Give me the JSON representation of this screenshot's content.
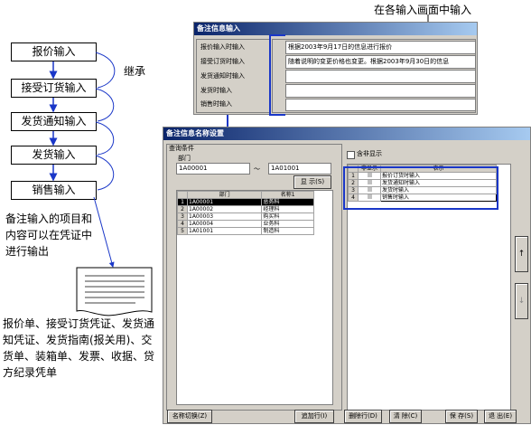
{
  "flow": {
    "steps": [
      "报价输入",
      "接受订货输入",
      "发货通知输入",
      "发货输入",
      "销售输入"
    ],
    "inherit_label": "继承",
    "note_lines": [
      "备注输入的项目和",
      "内容可以在凭证中",
      "进行输出"
    ],
    "docs_lines": [
      "报价单、接受订货凭证、发货通",
      "知凭证、发货指南(报关用)、交",
      "货单、装箱单、发票、收据、贷",
      "方纪录凭单"
    ]
  },
  "callout": "在各输入画面中输入",
  "remarks_window": {
    "title": "备注信息输入",
    "rows": [
      {
        "label": "报价输入时输入",
        "value": "根据2003年9月17日的信息进行报价"
      },
      {
        "label": "接受订货时输入",
        "value": "随着说明的变更价格也变更。根据2003年9月30日的信息"
      },
      {
        "label": "发货通知时输入",
        "value": ""
      },
      {
        "label": "发货时输入",
        "value": ""
      },
      {
        "label": "销售时输入",
        "value": ""
      }
    ]
  },
  "settings_window": {
    "title": "备注信息名称设置",
    "query_group": "查询条件",
    "dept_label": "部门",
    "dept_from": "1A00001",
    "range_sep": "～",
    "dept_to": "1A01001",
    "show_button": "显  示(S)",
    "nonshow_label": "含非显示",
    "dept_table": {
      "headers": [
        "部门",
        "名称1"
      ],
      "rows": [
        {
          "no": "1",
          "code": "1A00001",
          "name": "总务科"
        },
        {
          "no": "2",
          "code": "1A00002",
          "name": "经理科"
        },
        {
          "no": "3",
          "code": "1A00003",
          "name": "购买科"
        },
        {
          "no": "4",
          "code": "1A00004",
          "name": "业务科"
        },
        {
          "no": "5",
          "code": "1A01001",
          "name": "制造科"
        }
      ]
    },
    "name_table": {
      "headers": [
        "非显示",
        "表示"
      ],
      "rows": [
        {
          "no": "1",
          "name": "报价订货时输入"
        },
        {
          "no": "2",
          "name": "发货通知时输入"
        },
        {
          "no": "3",
          "name": "发货时输入"
        },
        {
          "no": "4",
          "name": "销售时输入"
        }
      ]
    },
    "up_arrow": "↑",
    "down_arrow": "↓",
    "buttons": {
      "switch": "名称切换(Z)",
      "add": "追加行(I)",
      "delete": "删除行(D)",
      "clear": "清  除(C)",
      "save": "保  存(S)",
      "exit": "退  出(E)"
    }
  }
}
